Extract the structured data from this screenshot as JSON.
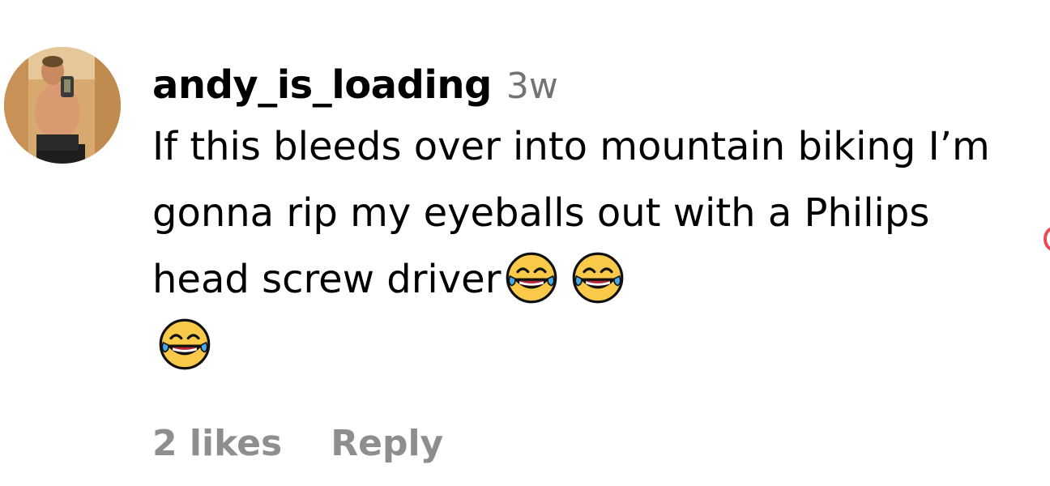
{
  "comment": {
    "username": "andy_is_loading",
    "timestamp": "3w",
    "text": "If this bleeds over into mountain biking I’m gonna rip my eyeballs out with a Philips head screw driver",
    "emojis": [
      "face-with-tears-of-joy-icon",
      "face-with-tears-of-joy-icon",
      "face-with-tears-of-joy-icon"
    ],
    "likes_label": "2 likes",
    "reply_label": "Reply",
    "like_icon": "heart-outline-icon",
    "like_color": "#ed4956"
  }
}
